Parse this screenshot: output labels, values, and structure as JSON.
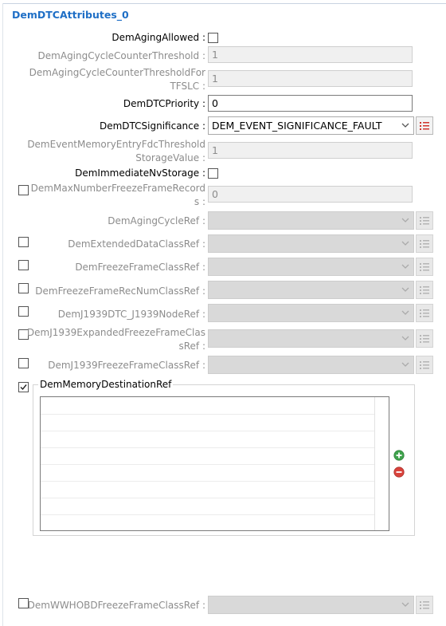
{
  "section_title": "DemDTCAttributes_0",
  "fields": {
    "aging_allowed": {
      "label": "DemAgingAllowed :",
      "checked": false
    },
    "aging_cycle_counter_threshold": {
      "label": "DemAgingCycleCounterThreshold :",
      "value": "1"
    },
    "aging_cycle_counter_threshold_tfslc": {
      "label_line1": "DemAgingCycleCounterThresholdFor",
      "label_line2": "TFSLC :",
      "value": "1"
    },
    "dtc_priority": {
      "label": "DemDTCPriority :",
      "value": "0"
    },
    "dtc_significance": {
      "label": "DemDTCSignificance :",
      "value": "DEM_EVENT_SIGNIFICANCE_FAULT"
    },
    "event_memory_entry_fdc": {
      "label_line1": "DemEventMemoryEntryFdcThreshold",
      "label_line2": "StorageValue :",
      "value": "1"
    },
    "immediate_nv_storage": {
      "label": "DemImmediateNvStorage :",
      "checked": false
    },
    "max_number_freeze_frame_records": {
      "label_line1": "DemMaxNumberFreezeFrameRecord",
      "label_line2": "s :",
      "value": "0",
      "enabled": false
    },
    "aging_cycle_ref": {
      "label": "DemAgingCycleRef :"
    },
    "extended_data_class_ref": {
      "label": "DemExtendedDataClassRef :",
      "enabled": false
    },
    "freeze_frame_class_ref": {
      "label": "DemFreezeFrameClassRef :",
      "enabled": false
    },
    "freeze_frame_rec_num_class_ref": {
      "label": "DemFreezeFrameRecNumClassRef :",
      "enabled": false
    },
    "j1939_dtc_node_ref": {
      "label": "DemJ1939DTC_J1939NodeRef :",
      "enabled": false
    },
    "j1939_expanded_freeze_frame_class_ref": {
      "label_line1": "DemJ1939ExpandedFreezeFrameClas",
      "label_line2": "sRef :",
      "enabled": false
    },
    "j1939_freeze_frame_class_ref": {
      "label": "DemJ1939FreezeFrameClassRef :",
      "enabled": false
    },
    "memory_destination_ref": {
      "label": "DemMemoryDestinationRef",
      "enabled": true
    },
    "wwhobd_freeze_frame_class_ref": {
      "label": "DemWWHOBDFreezeFrameClassRef :",
      "enabled": false
    }
  },
  "icons": {
    "dropdown": "chevron-down-icon",
    "list": "list-icon",
    "add": "add-icon",
    "remove": "remove-icon",
    "checkbox_checked": "checkmark-icon"
  },
  "colors": {
    "title": "#1f6fc6",
    "disabled_text": "#8c8c8c",
    "list_icon_active": "#d0342c",
    "add_green": "#3fa34d",
    "remove_red": "#d9433c"
  }
}
